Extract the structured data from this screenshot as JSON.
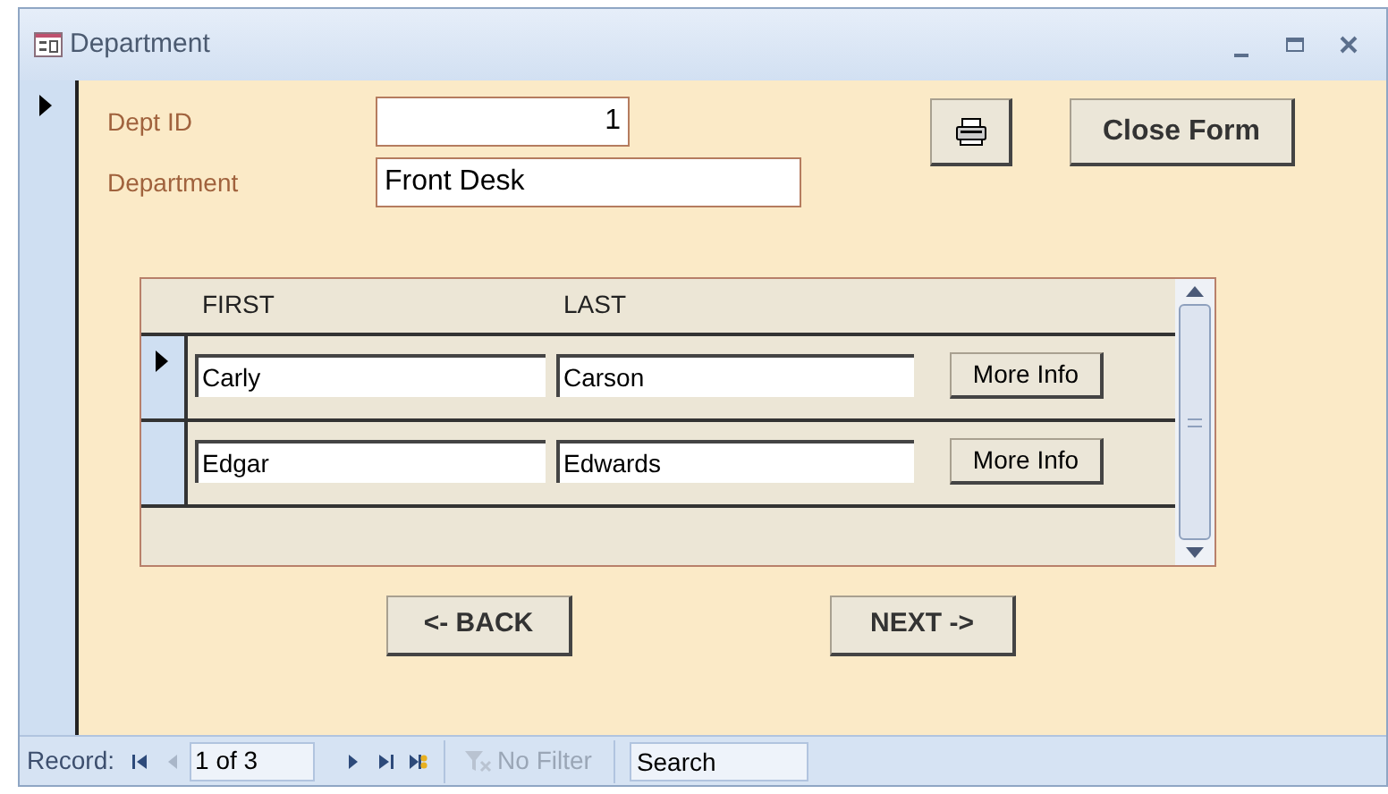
{
  "window": {
    "title": "Department"
  },
  "form": {
    "current_record": true,
    "fields": [
      {
        "label": "Dept ID",
        "value": "1"
      },
      {
        "label": "Department",
        "value": "Front Desk"
      }
    ],
    "buttons": [
      {
        "kind": "print"
      },
      {
        "kind": "text",
        "label": "Close Form"
      }
    ]
  },
  "subform": {
    "columns": [
      "FIRST",
      "LAST"
    ],
    "rows": [
      {
        "first": "Carly",
        "last": "Carson",
        "button": "More Info",
        "selected": true
      },
      {
        "first": "Edgar",
        "last": "Edwards",
        "button": "More Info",
        "selected": false
      }
    ]
  },
  "nav_buttons": [
    "<- BACK",
    "NEXT ->"
  ],
  "navigation": {
    "label": "Record:",
    "position": "1 of 3",
    "controls": [
      {
        "kind": "first",
        "disabled": false
      },
      {
        "kind": "previous",
        "disabled": true
      },
      {
        "kind": "next",
        "disabled": false
      },
      {
        "kind": "last",
        "disabled": false
      },
      {
        "kind": "new",
        "disabled": false
      }
    ],
    "filter": {
      "label": "No Filter",
      "disabled": true
    },
    "search": {
      "placeholder": "Search"
    }
  }
}
